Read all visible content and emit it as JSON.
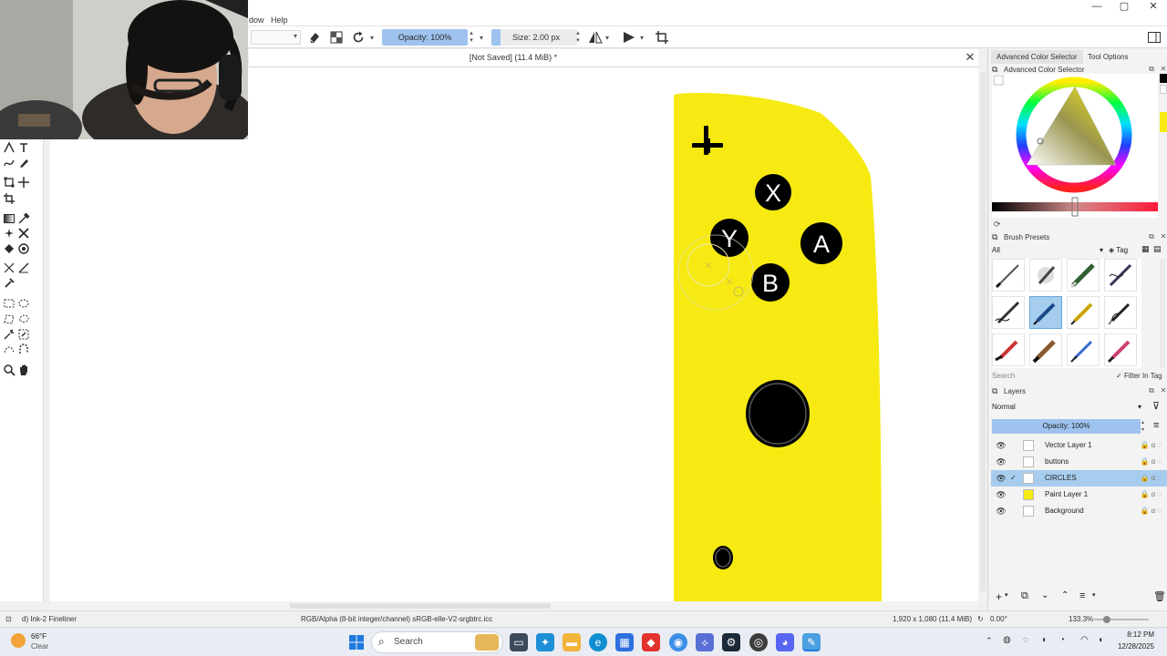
{
  "window": {
    "controls": {
      "minimize": "—",
      "maximize": "▢",
      "close": "✕"
    }
  },
  "menu": {
    "items": [
      "dow",
      "Help"
    ]
  },
  "toolbar": {
    "opacity_label": "Opacity: 100%",
    "size_label": "Size: 2.00 px",
    "eraser_icon": "eraser-icon",
    "alpha_icon": "preserve-alpha-icon",
    "reload_icon": "reload-preset-icon"
  },
  "document": {
    "tab_title": "[Not Saved]  (11.4 MiB) *",
    "close_glyph": "✕"
  },
  "canvas": {
    "controller_color": "#f6ea12",
    "buttons": {
      "x": "X",
      "y": "Y",
      "a": "A",
      "b": "B"
    },
    "dpad_glyph": "✚"
  },
  "dockers": {
    "top_tabs": [
      "Advanced Color Selector",
      "Tool Options"
    ],
    "color_selector_title": "Advanced Color Selector",
    "brush_presets": {
      "title": "Brush Presets",
      "filter_value": "All",
      "tag_label": "Tag",
      "search_placeholder": "Search",
      "filter_in_tag": "Filter In Tag"
    },
    "layers": {
      "title": "Layers",
      "blend_mode": "Normal",
      "opacity_label": "Opacity:  100%",
      "items": [
        {
          "name": "Vector Layer 1",
          "thumb": "#ffffff"
        },
        {
          "name": "buttons",
          "thumb": "#ffffff"
        },
        {
          "name": "CIRCLES",
          "thumb": "#ffffff"
        },
        {
          "name": "Paint Layer 1",
          "thumb": "#f6ea12"
        },
        {
          "name": "Background",
          "thumb": "#ffffff"
        }
      ]
    }
  },
  "status": {
    "brush": "d) Ink-2 Fineliner",
    "color_space": "RGB/Alpha (8-bit integer/channel)  sRGB-elle-V2-srgbtrc.icc",
    "dimensions": "1,920 x 1,080 (11.4 MiB)",
    "rotation": "0.00°",
    "zoom": "133.3%"
  },
  "taskbar": {
    "weather_temp": "66°F",
    "weather_desc": "Clear",
    "search_label": "Search",
    "time": "8:12 PM",
    "date": "12/28/2025"
  },
  "colors": {
    "accent_blue": "#9ec3ee",
    "selected_layer": "#a7cdee",
    "swatch_yellow": "#f6ea12"
  }
}
